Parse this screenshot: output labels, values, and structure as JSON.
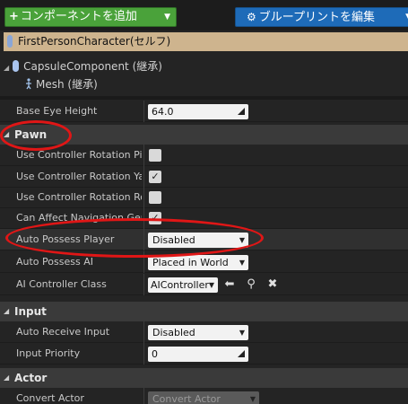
{
  "toolbar": {
    "add_component_label": "コンポーネントを追加",
    "add_component_plus": "+",
    "blueprint_label": "ブループリントを編集"
  },
  "root": {
    "label": "FirstPersonCharacter(セルフ)"
  },
  "tree": {
    "capsule_label": "CapsuleComponent (継承)",
    "mesh_label": "Mesh (継承)"
  },
  "properties": {
    "base_eye_height": {
      "label": "Base Eye Height",
      "value": "64.0"
    }
  },
  "pawn": {
    "title": "Pawn",
    "rows": [
      {
        "label": "Use Controller Rotation Pitch",
        "checked": false
      },
      {
        "label": "Use Controller Rotation Yaw",
        "checked": true,
        "mark": "✓"
      },
      {
        "label": "Use Controller Rotation Roll",
        "checked": false
      },
      {
        "label": "Can Affect Navigation Generation",
        "checked": true,
        "mark": "✓"
      }
    ],
    "auto_possess_player": {
      "label": "Auto Possess Player",
      "value": "Disabled"
    },
    "auto_possess_ai": {
      "label": "Auto Possess AI",
      "value": "Placed in World"
    },
    "ai_controller_class": {
      "label": "AI Controller Class",
      "value": "AIController"
    }
  },
  "input": {
    "title": "Input",
    "auto_receive_input": {
      "label": "Auto Receive Input",
      "value": "Disabled"
    },
    "input_priority": {
      "label": "Input Priority",
      "value": "0"
    }
  },
  "actor": {
    "title": "Actor",
    "convert_actor": {
      "label": "Convert Actor",
      "value": "Convert Actor"
    }
  },
  "colors": {
    "add_button": "#4aa23a",
    "blueprint_button": "#1e6bb8",
    "root_row": "#ceb48e",
    "annotation": "#e01616"
  }
}
